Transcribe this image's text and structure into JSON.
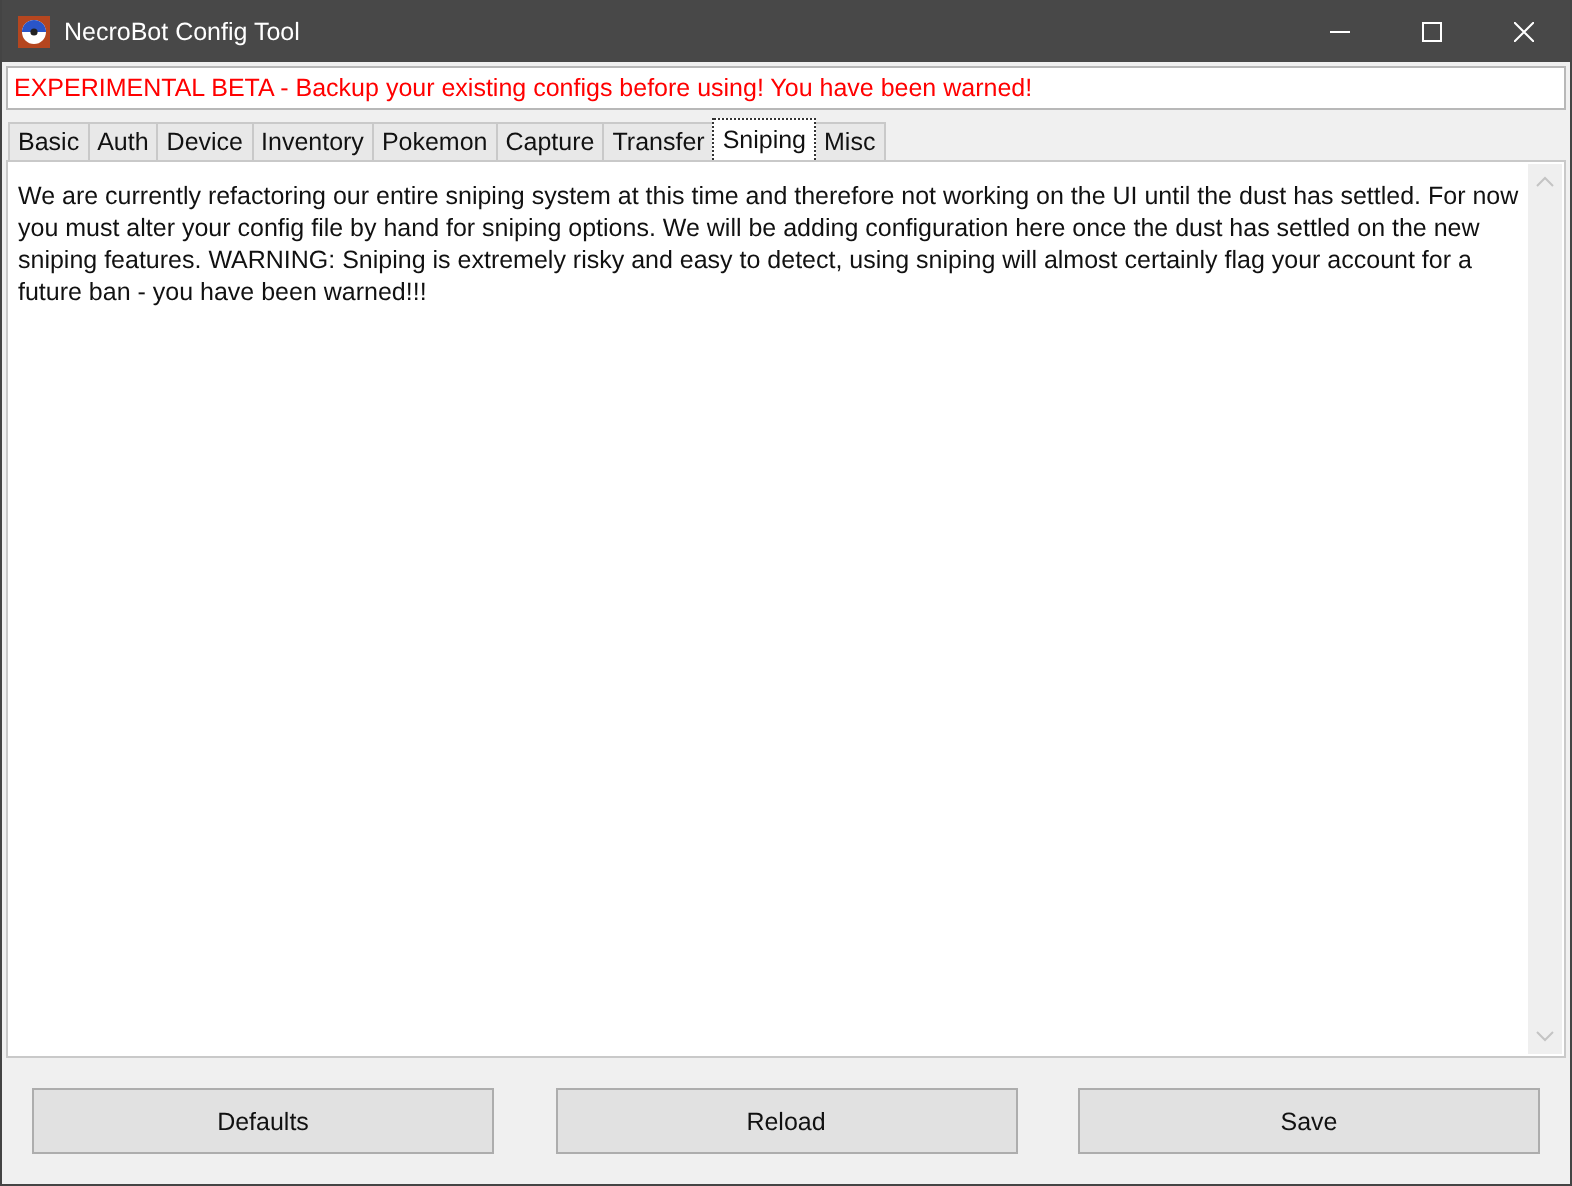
{
  "window": {
    "title": "NecroBot Config Tool"
  },
  "warning": "EXPERIMENTAL BETA - Backup your existing configs before using! You have been warned!",
  "tabs": [
    {
      "label": "Basic",
      "selected": false
    },
    {
      "label": "Auth",
      "selected": false
    },
    {
      "label": "Device",
      "selected": false
    },
    {
      "label": "Inventory",
      "selected": false
    },
    {
      "label": "Pokemon",
      "selected": false
    },
    {
      "label": "Capture",
      "selected": false
    },
    {
      "label": "Transfer",
      "selected": false
    },
    {
      "label": "Sniping",
      "selected": true
    },
    {
      "label": "Misc",
      "selected": false
    }
  ],
  "message": "We are currently refactoring our entire sniping system at this time and therefore not working on the UI until the dust has settled. For now you must alter your config file by hand for sniping options. We will be adding configuration here once the dust has settled on the new sniping features. WARNING: Sniping is extremely risky and easy to detect, using sniping will almost certainly flag your account for a future ban - you have been warned!!!",
  "buttons": [
    "Defaults",
    "Reload",
    "Save"
  ]
}
